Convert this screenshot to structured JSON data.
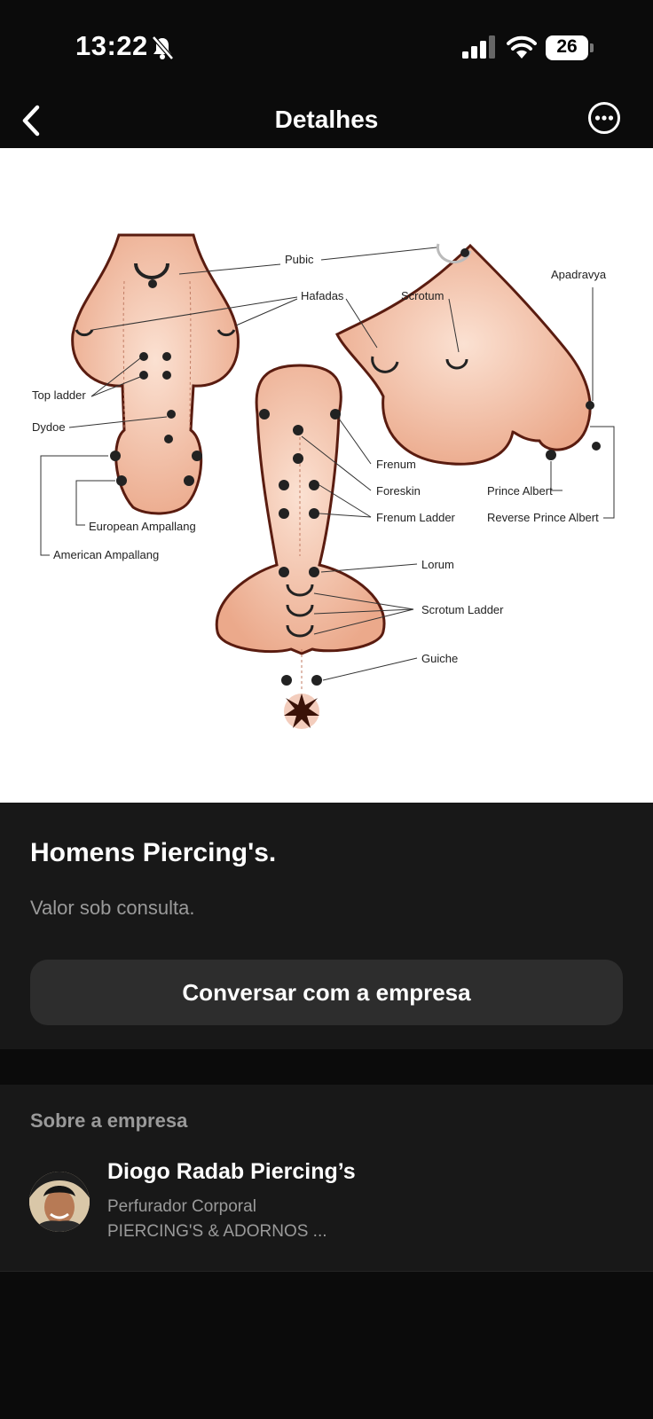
{
  "status_bar": {
    "time": "13:22",
    "battery": "26"
  },
  "nav": {
    "title": "Detalhes"
  },
  "image": {
    "labels": {
      "pubic": "Pubic",
      "hafadas": "Hafadas",
      "scrotum": "Scrotum",
      "apadravya": "Apadravya",
      "top_ladder": "Top ladder",
      "dydoe": "Dydoe",
      "frenum": "Frenum",
      "foreskin": "Foreskin",
      "prince_albert": "Prince Albert",
      "frenum_ladder": "Frenum Ladder",
      "reverse_prince_albert": "Reverse Prince Albert",
      "european_ampallang": "European Ampallang",
      "american_ampallang": "American Ampallang",
      "lorum": "Lorum",
      "scrotum_ladder": "Scrotum Ladder",
      "guiche": "Guiche"
    }
  },
  "product": {
    "title": "Homens Piercing's.",
    "price": "Valor sob consulta.",
    "chat_button": "Conversar com a empresa"
  },
  "company": {
    "section_label": "Sobre a empresa",
    "name": "Diogo Radab Piercing’s",
    "subtitle": "Perfurador Corporal",
    "category": "PIERCING'S & ADORNOS ..."
  }
}
